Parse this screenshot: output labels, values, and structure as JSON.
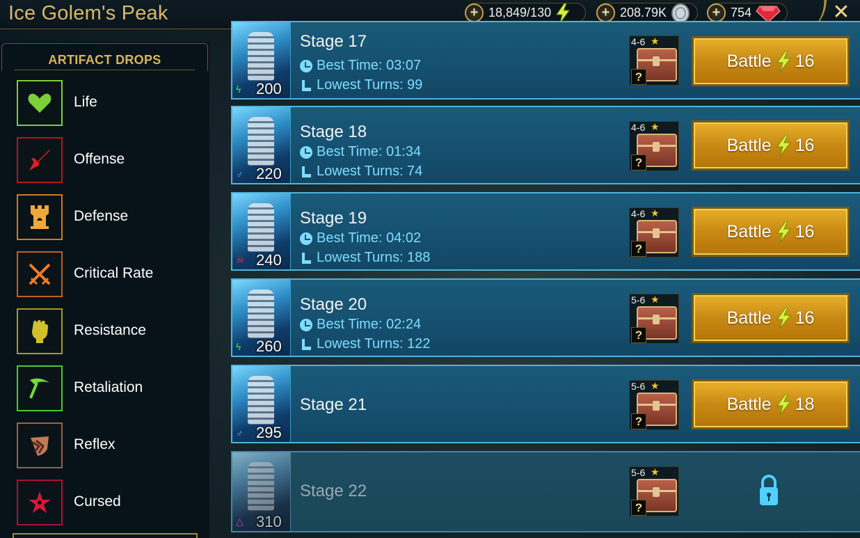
{
  "header": {
    "title": "Ice Golem's Peak",
    "energy": "18,849/130",
    "silver": "208.79K",
    "gems": "754",
    "close_glyph": "✕"
  },
  "sidebar": {
    "title": "ARTIFACT DROPS",
    "items": [
      {
        "label": "Life",
        "icon": "heart-icon",
        "color": "#7ccf38"
      },
      {
        "label": "Offense",
        "icon": "sword-icon",
        "color": "#d92020"
      },
      {
        "label": "Defense",
        "icon": "tower-icon",
        "color": "#e0902a"
      },
      {
        "label": "Critical Rate",
        "icon": "crossed-swords-icon",
        "color": "#e06a20"
      },
      {
        "label": "Resistance",
        "icon": "fist-icon",
        "color": "#c2b020"
      },
      {
        "label": "Retaliation",
        "icon": "pickaxe-icon",
        "color": "#60d030"
      },
      {
        "label": "Reflex",
        "icon": "shield-arrow-icon",
        "color": "#c07050"
      },
      {
        "label": "Cursed",
        "icon": "pentagram-icon",
        "color": "#d81838"
      }
    ]
  },
  "stages": [
    {
      "name": "Stage 17",
      "power": "200",
      "affinity": "ϟ",
      "affinity_color": "#3ad040",
      "best_time_label": "Best Time: 03:07",
      "lowest_turns_label": "Lowest Turns: 99",
      "rank": "4-6",
      "battle_label": "Battle",
      "energy_cost": "16",
      "locked": false
    },
    {
      "name": "Stage 18",
      "power": "220",
      "affinity": "♂",
      "affinity_color": "#5fb4f0",
      "best_time_label": "Best Time: 01:34",
      "lowest_turns_label": "Lowest Turns: 74",
      "rank": "4-6",
      "battle_label": "Battle",
      "energy_cost": "16",
      "locked": false
    },
    {
      "name": "Stage 19",
      "power": "240",
      "affinity": "☠",
      "affinity_color": "#e03030",
      "best_time_label": "Best Time: 04:02",
      "lowest_turns_label": "Lowest Turns: 188",
      "rank": "4-6",
      "battle_label": "Battle",
      "energy_cost": "16",
      "locked": false
    },
    {
      "name": "Stage 20",
      "power": "260",
      "affinity": "ϟ",
      "affinity_color": "#3ad040",
      "best_time_label": "Best Time: 02:24",
      "lowest_turns_label": "Lowest Turns: 122",
      "rank": "5-6",
      "battle_label": "Battle",
      "energy_cost": "16",
      "locked": false
    },
    {
      "name": "Stage 21",
      "power": "295",
      "affinity": "♂",
      "affinity_color": "#5fb4f0",
      "rank": "5-6",
      "battle_label": "Battle",
      "energy_cost": "18",
      "locked": false
    },
    {
      "name": "Stage 22",
      "power": "310",
      "affinity": "△",
      "affinity_color": "#b040d0",
      "rank": "5-6",
      "locked": true
    }
  ]
}
